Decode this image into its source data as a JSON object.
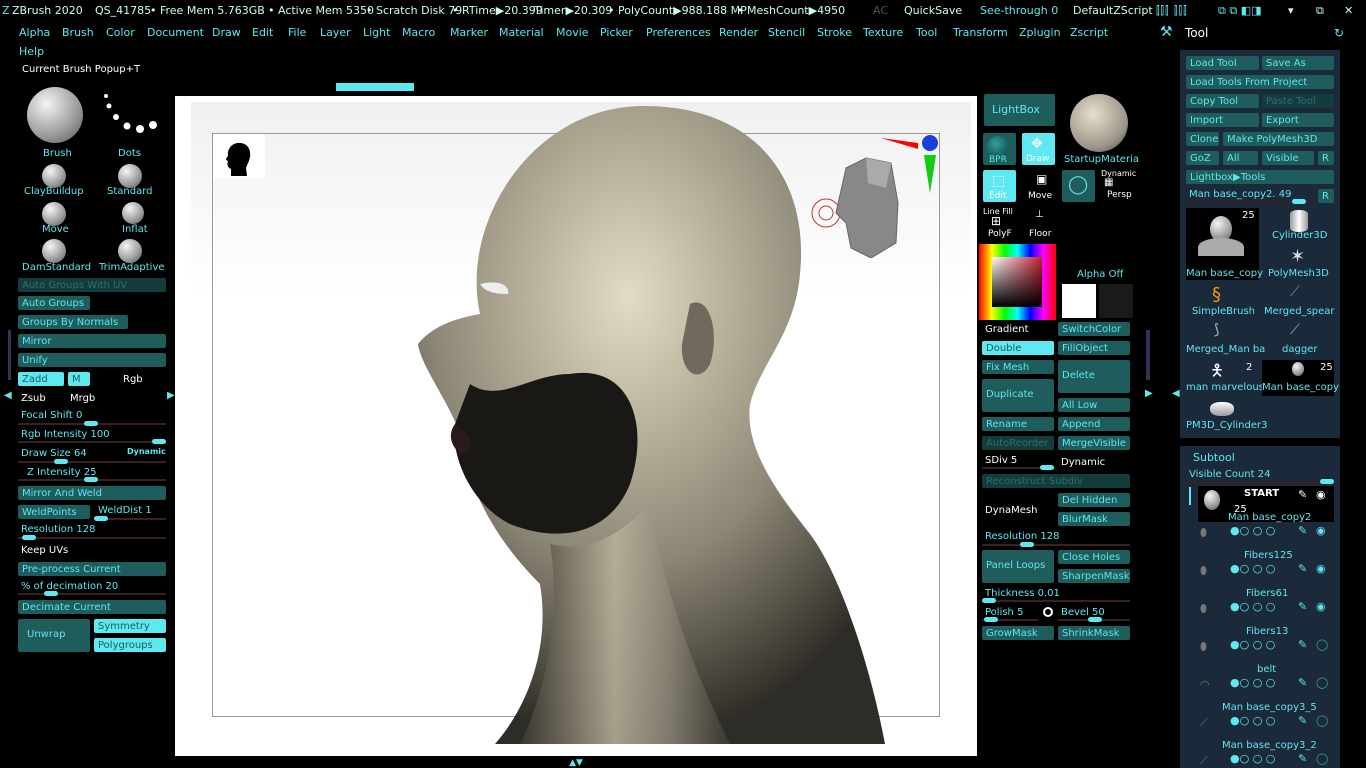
{
  "topbar": {
    "app": "ZBrush 2020",
    "doc": "QS_41785",
    "free_mem": "• Free Mem 5.763GB",
    "active_mem": "• Active Mem 5350",
    "scratch": "• Scratch Disk 79",
    "rtime": "• RTime▶20.399",
    "timer": "Timer▶20.309",
    "polycount": "• PolyCount▶988.188 MP",
    "meshcount": "• MeshCount▶4950",
    "ac": "AC",
    "quicksave": "QuickSave",
    "seethrough": "See-through  0",
    "script": "DefaultZScript"
  },
  "menus": [
    "Alpha",
    "Brush",
    "Color",
    "Document",
    "Draw",
    "Edit",
    "File",
    "Layer",
    "Light",
    "Macro",
    "Marker",
    "Material",
    "Movie",
    "Picker",
    "Preferences",
    "Render",
    "Stencil",
    "Stroke",
    "Texture",
    "Tool",
    "Transform",
    "Zplugin",
    "Zscript",
    "Help"
  ],
  "current_brush": "Current Brush",
  "popup": "Popup+T",
  "left_shelf": {
    "brush": "Brush",
    "dots": "Dots",
    "claybuildup": "ClayBuildup",
    "standard": "Standard",
    "move": "Move",
    "inflat": "Inflat",
    "damstandard": "DamStandard",
    "trimadaptive": "TrimAdaptive"
  },
  "left_panel": {
    "auto_groups_uv": "Auto Groups With UV",
    "auto_groups": "Auto Groups",
    "groups_by_normals": "Groups By Normals",
    "mirror": "Mirror",
    "unify": "Unify",
    "zadd": "Zadd",
    "m": "M",
    "rgb": "Rgb",
    "zsub": "Zsub",
    "mrgb": "Mrgb",
    "focal_shift": "Focal Shift 0",
    "rgb_intensity": "Rgb Intensity 100",
    "draw_size": "Draw Size 64",
    "dynamic": "Dynamic",
    "z_intensity": "Z Intensity 25",
    "mirror_weld": "Mirror And Weld",
    "weldpoints": "WeldPoints",
    "welddist": "WeldDist 1",
    "resolution": "Resolution 128",
    "keep_uvs": "Keep UVs",
    "preprocess": "Pre-process Current",
    "decimation": "% of decimation 20",
    "decimate": "Decimate Current",
    "unwrap": "Unwrap",
    "symmetry": "Symmetry",
    "polygroups": "Polygroups"
  },
  "mid_panel": {
    "lightbox": "LightBox",
    "bpr": "BPR",
    "draw": "Draw",
    "startup_material": "StartupMateria",
    "edit": "Edit",
    "move": "Move",
    "dynamic_persp": "Dynamic",
    "persp": "Persp",
    "line_fill": "Line Fill",
    "polyf": "PolyF",
    "floor": "Floor",
    "alpha_off": "Alpha Off",
    "gradient": "Gradient",
    "switchcolor": "SwitchColor",
    "double": "Double",
    "fillobject": "FillObject",
    "fix_mesh": "Fix Mesh",
    "delete": "Delete",
    "all_low": "All Low",
    "duplicate": "Duplicate",
    "append": "Append",
    "rename": "Rename",
    "auto_reorder": "AutoReorder",
    "mergevisible": "MergeVisible",
    "sdiv": "SDiv 5",
    "dynamic2": "Dynamic",
    "reconstruct": "Reconstruct Subdiv",
    "dynamesh": "DynaMesh",
    "del_hidden": "Del Hidden",
    "blurmask": "BlurMask",
    "resolution": "Resolution 128",
    "panel_loops": "Panel Loops",
    "close_holes": "Close Holes",
    "sharpenmask": "SharpenMask",
    "thickness": "Thickness 0.01",
    "polish": "Polish 5",
    "bevel": "Bevel 50",
    "growmask": "GrowMask",
    "shrinkmask": "ShrinkMask"
  },
  "tool_panel": {
    "title": "Tool",
    "load_tool": "Load Tool",
    "save_as": "Save As",
    "load_from_project": "Load Tools From Project",
    "copy_tool": "Copy Tool",
    "paste_tool": "Paste Tool",
    "import": "Import",
    "export": "Export",
    "clone": "Clone",
    "make_polymesh": "Make PolyMesh3D",
    "goz": "GoZ",
    "all": "All",
    "visible": "Visible",
    "r": "R",
    "lightbox_tools": "Lightbox▶Tools",
    "current_tool": "Man base_copy2. 49",
    "tools": [
      {
        "name": "Man base_copy",
        "count": "25"
      },
      {
        "name": "Cylinder3D",
        "count": ""
      },
      {
        "name": "PolyMesh3D",
        "count": ""
      },
      {
        "name": "SimpleBrush",
        "count": ""
      },
      {
        "name": "Merged_spear",
        "count": ""
      },
      {
        "name": "Merged_Man ba",
        "count": ""
      },
      {
        "name": "dagger",
        "count": ""
      },
      {
        "name": "man marvelous",
        "count": "2"
      },
      {
        "name": "Man base_copy",
        "count": "25"
      },
      {
        "name": "PM3D_Cylinder3",
        "count": ""
      }
    ]
  },
  "subtool": {
    "title": "Subtool",
    "visible_count": "Visible Count 24",
    "start": "START",
    "items": [
      {
        "name": "Man base_copy2",
        "count": "25"
      },
      {
        "name": "Fibers125",
        "count": ""
      },
      {
        "name": "Fibers61",
        "count": ""
      },
      {
        "name": "Fibers13",
        "count": ""
      },
      {
        "name": "belt",
        "count": ""
      },
      {
        "name": "Man base_copy3_5",
        "count": ""
      },
      {
        "name": "Man base_copy3_2",
        "count": ""
      }
    ]
  },
  "colors": {
    "accent": "#5ee8f0",
    "button": "#1f5c5c",
    "panel": "#1a2a3a"
  }
}
